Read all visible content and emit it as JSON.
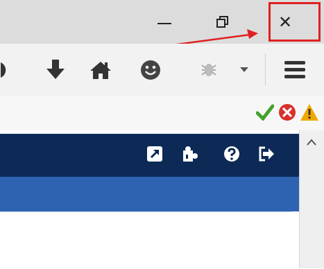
{
  "window_controls": {
    "minimize": "minimize-icon",
    "restore": "restore-icon",
    "close": "close-icon",
    "close_glyph": "✕"
  },
  "annotation": {
    "color": "#e02020",
    "target": "close-button"
  },
  "toolbar": {
    "items": [
      "partial-icon",
      "download-icon",
      "home-icon",
      "smiley-icon",
      "bug-icon",
      "dropdown-arrow-icon",
      "hamburger-menu-icon"
    ]
  },
  "status_icons": [
    "check-icon",
    "error-icon",
    "warning-icon"
  ],
  "app_header": {
    "background": "#0d2a57",
    "icons": [
      "external-link-icon",
      "puzzle-icon",
      "help-icon",
      "sign-out-icon"
    ]
  },
  "colors": {
    "titlebar": "#dcdcdc",
    "toolbar": "#f2f2f2",
    "blue_band": "#2e63b2",
    "check": "#44a22a",
    "error": "#d9302c",
    "warning": "#f0a800"
  }
}
